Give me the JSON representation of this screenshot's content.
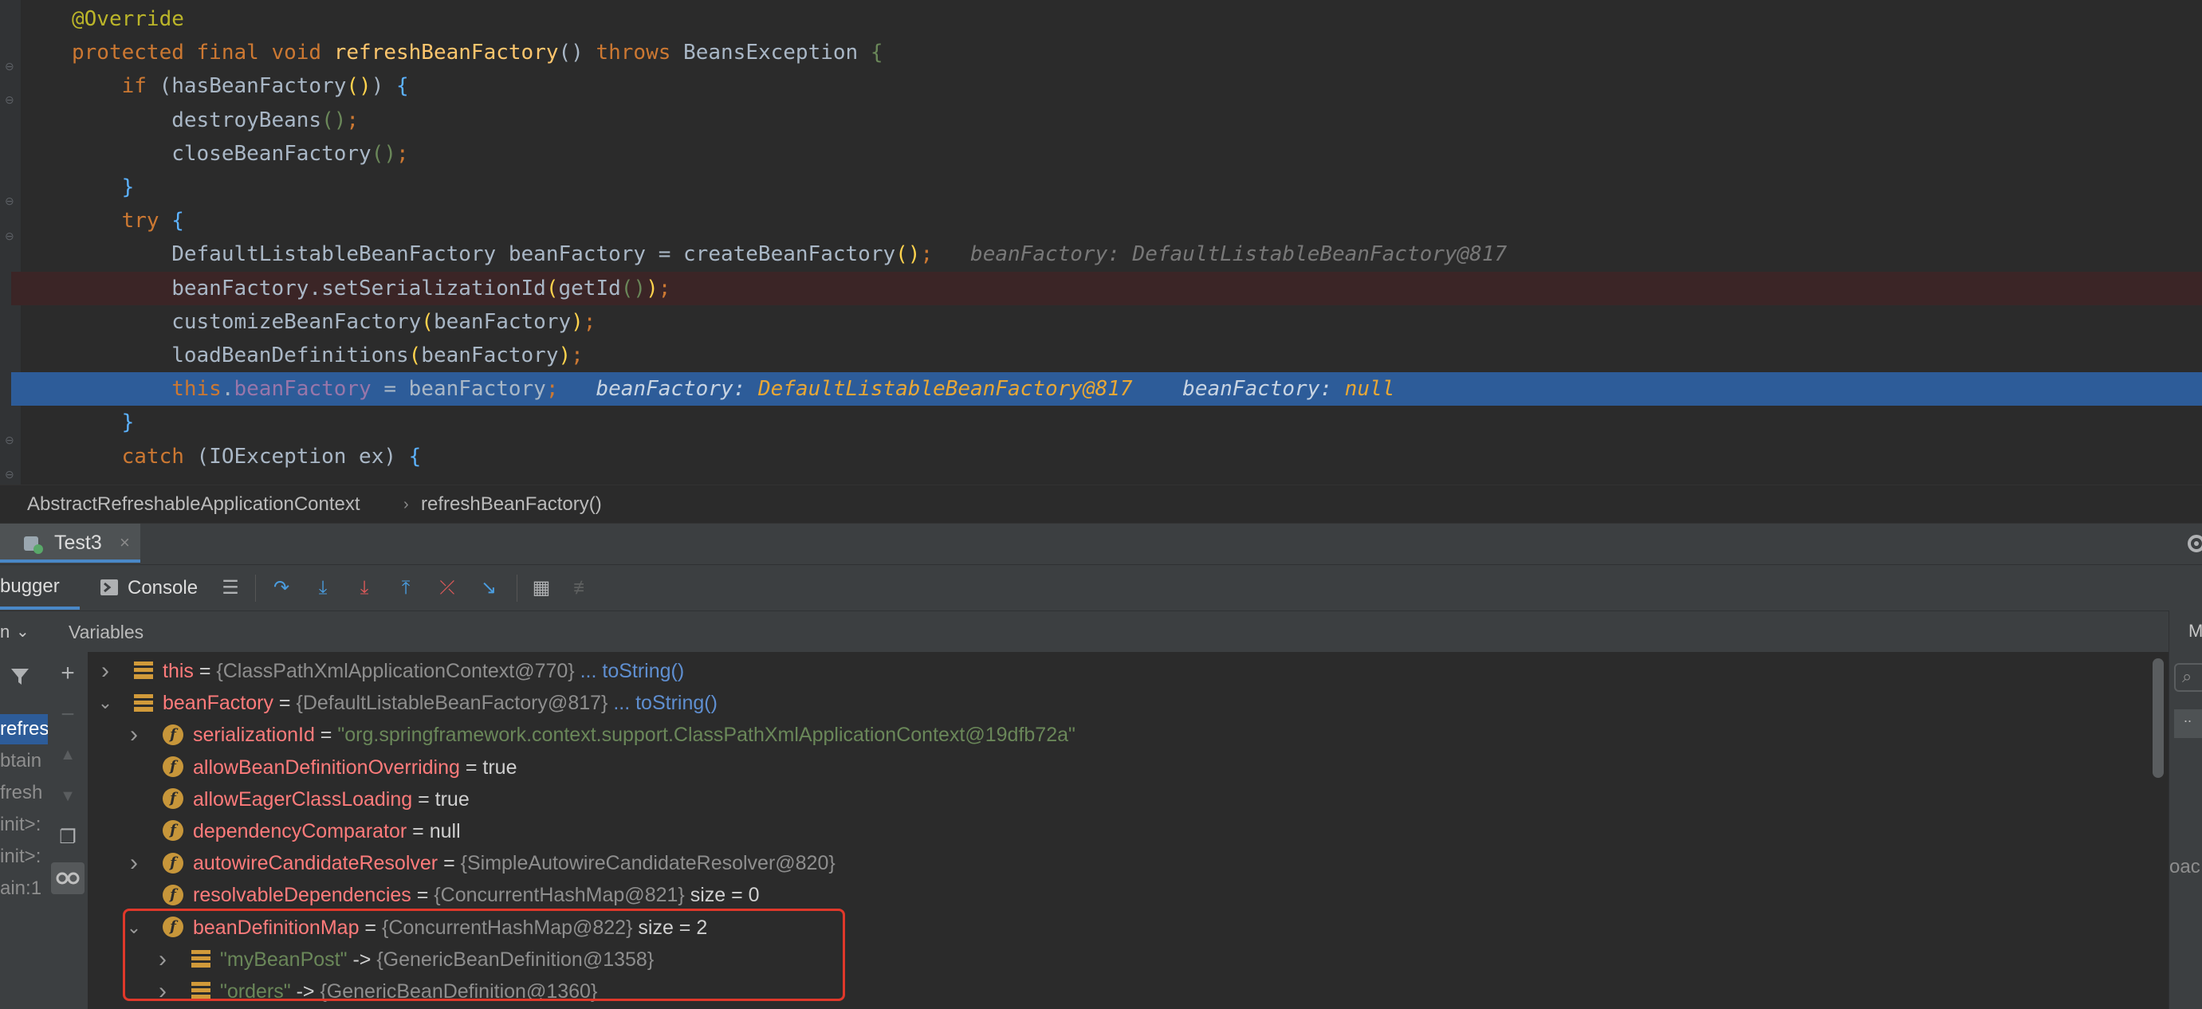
{
  "editor": {
    "lines": [
      {
        "tokens": [
          {
            "t": "@Override",
            "c": "ann"
          }
        ]
      },
      {
        "tokens": [
          {
            "t": "protected final void ",
            "c": "kw"
          },
          {
            "t": "refreshBeanFactory",
            "c": "fn"
          },
          {
            "t": "() ",
            "c": ""
          },
          {
            "t": "throws ",
            "c": "kw"
          },
          {
            "t": "BeansException ",
            "c": ""
          },
          {
            "t": "{",
            "c": "gr"
          }
        ]
      },
      {
        "tokens": [
          {
            "t": "    if ",
            "c": "kw"
          },
          {
            "t": "(hasBeanFactory",
            "c": ""
          },
          {
            "t": "()",
            "c": "brk"
          },
          {
            "t": ") ",
            "c": ""
          },
          {
            "t": "{",
            "c": "bb"
          }
        ]
      },
      {
        "tokens": [
          {
            "t": "        destroyBeans",
            "c": ""
          },
          {
            "t": "()",
            "c": "gr"
          },
          {
            "t": ";",
            "c": "kw"
          }
        ]
      },
      {
        "tokens": [
          {
            "t": "        closeBeanFactory",
            "c": ""
          },
          {
            "t": "()",
            "c": "gr"
          },
          {
            "t": ";",
            "c": "kw"
          }
        ]
      },
      {
        "tokens": [
          {
            "t": "    }",
            "c": "bb"
          }
        ]
      },
      {
        "tokens": [
          {
            "t": "    try ",
            "c": "kw"
          },
          {
            "t": "{",
            "c": "bb"
          }
        ]
      },
      {
        "tokens": [
          {
            "t": "        DefaultListableBeanFactory beanFactory = createBeanFactory",
            "c": ""
          },
          {
            "t": "()",
            "c": "brk"
          },
          {
            "t": ";",
            "c": "kw"
          },
          {
            "t": "   beanFactory: DefaultListableBeanFactory@817",
            "c": "hint"
          }
        ]
      },
      {
        "bg": "err",
        "tokens": [
          {
            "t": "        beanFactory.setSerializationId",
            "c": ""
          },
          {
            "t": "(",
            "c": "brk"
          },
          {
            "t": "getId",
            "c": ""
          },
          {
            "t": "()",
            "c": "gr"
          },
          {
            "t": ")",
            "c": "brk"
          },
          {
            "t": ";",
            "c": "kw"
          }
        ]
      },
      {
        "tokens": [
          {
            "t": "        customizeBeanFactory",
            "c": ""
          },
          {
            "t": "(",
            "c": "brk"
          },
          {
            "t": "beanFactory",
            "c": ""
          },
          {
            "t": ")",
            "c": "brk"
          },
          {
            "t": ";",
            "c": "kw"
          }
        ]
      },
      {
        "tokens": [
          {
            "t": "        loadBeanDefinitions",
            "c": ""
          },
          {
            "t": "(",
            "c": "brk"
          },
          {
            "t": "beanFactory",
            "c": ""
          },
          {
            "t": ")",
            "c": "brk"
          },
          {
            "t": ";",
            "c": "kw"
          }
        ]
      },
      {
        "bg": "sel",
        "tokens": [
          {
            "t": "        this",
            "c": "kw"
          },
          {
            "t": ".",
            "c": ""
          },
          {
            "t": "beanFactory",
            "c": "fld"
          },
          {
            "t": " = beanFactory",
            "c": ""
          },
          {
            "t": ";",
            "c": "kw"
          },
          {
            "t": "   beanFactory: ",
            "c": "hint-hl"
          },
          {
            "t": "DefaultListableBeanFactory@817",
            "c": "hint-val"
          },
          {
            "t": "    beanFactory: ",
            "c": "hint-hl"
          },
          {
            "t": "null",
            "c": "hint-val"
          }
        ]
      },
      {
        "tokens": [
          {
            "t": "    }",
            "c": "bb"
          }
        ]
      },
      {
        "tokens": [
          {
            "t": "    catch ",
            "c": "kw"
          },
          {
            "t": "(IOException ex) ",
            "c": ""
          },
          {
            "t": "{",
            "c": "bb"
          }
        ]
      }
    ]
  },
  "breadcrumb": {
    "class_name": "AbstractRefreshableApplicationContext",
    "method_name": "refreshBeanFactory()"
  },
  "debug": {
    "session_tab": "Test3",
    "tabs": {
      "debugger": "bugger",
      "console": "Console"
    },
    "variables_header": "Variables",
    "right_header": "M",
    "right_partial": "oac",
    "frames": [
      "refresh",
      "btain",
      "fresh",
      "init>:",
      "init>:",
      "ain:1"
    ]
  },
  "variables": [
    {
      "arrow": "right",
      "indent": 0,
      "icon": "rows",
      "name": "this",
      "rest": [
        {
          "t": " = ",
          "c": "vwhite"
        },
        {
          "t": "{ClassPathXmlApplicationContext@770}",
          "c": "vgray"
        },
        {
          "t": "  ... toString()",
          "c": "vlink"
        }
      ]
    },
    {
      "arrow": "down",
      "indent": 0,
      "icon": "rows",
      "name": "beanFactory",
      "rest": [
        {
          "t": " = ",
          "c": "vwhite"
        },
        {
          "t": "{DefaultListableBeanFactory@817}",
          "c": "vgray"
        },
        {
          "t": "  ... toString()",
          "c": "vlink"
        }
      ]
    },
    {
      "arrow": "right",
      "indent": 1,
      "icon": "f",
      "name": "serializationId",
      "rest": [
        {
          "t": " = ",
          "c": "vwhite"
        },
        {
          "t": "\"org.springframework.context.support.ClassPathXmlApplicationContext@19dfb72a\"",
          "c": "vstr"
        }
      ]
    },
    {
      "arrow": "",
      "indent": 1,
      "icon": "f",
      "name": "allowBeanDefinitionOverriding",
      "rest": [
        {
          "t": " = true",
          "c": "vwhite"
        }
      ]
    },
    {
      "arrow": "",
      "indent": 1,
      "icon": "f",
      "name": "allowEagerClassLoading",
      "rest": [
        {
          "t": " = true",
          "c": "vwhite"
        }
      ]
    },
    {
      "arrow": "",
      "indent": 1,
      "icon": "f",
      "name": "dependencyComparator",
      "rest": [
        {
          "t": " = null",
          "c": "vwhite"
        }
      ]
    },
    {
      "arrow": "right",
      "indent": 1,
      "icon": "f",
      "name": "autowireCandidateResolver",
      "rest": [
        {
          "t": " = ",
          "c": "vwhite"
        },
        {
          "t": "{SimpleAutowireCandidateResolver@820}",
          "c": "vgray"
        }
      ]
    },
    {
      "arrow": "",
      "indent": 1,
      "icon": "f",
      "name": "resolvableDependencies",
      "rest": [
        {
          "t": " = ",
          "c": "vwhite"
        },
        {
          "t": "{ConcurrentHashMap@821}",
          "c": "vgray"
        },
        {
          "t": "  size = 0",
          "c": "vwhite"
        }
      ]
    },
    {
      "arrow": "down",
      "indent": 1,
      "icon": "f",
      "name": "beanDefinitionMap",
      "rest": [
        {
          "t": " = ",
          "c": "vwhite"
        },
        {
          "t": "{ConcurrentHashMap@822}",
          "c": "vgray"
        },
        {
          "t": "  size = 2",
          "c": "vwhite"
        }
      ]
    },
    {
      "arrow": "right",
      "indent": 2,
      "icon": "rows",
      "name": "\"myBeanPost\"",
      "name_class": "vstr",
      "rest": [
        {
          "t": " -> ",
          "c": "vwhite"
        },
        {
          "t": "{GenericBeanDefinition@1358}",
          "c": "vgray"
        }
      ]
    },
    {
      "arrow": "right",
      "indent": 2,
      "icon": "rows",
      "name": "\"orders\"",
      "name_class": "vstr",
      "rest": [
        {
          "t": " -> ",
          "c": "vwhite"
        },
        {
          "t": "{GenericBeanDefinition@1360}",
          "c": "vgray"
        }
      ]
    }
  ],
  "colors": {
    "highlight_box": "#e0382a",
    "selection": "#2d5c99",
    "error_line": "#3b2526"
  }
}
